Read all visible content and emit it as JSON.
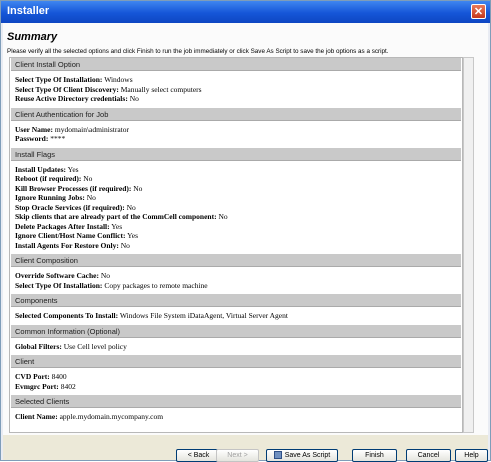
{
  "window": {
    "title": "Installer"
  },
  "heading": "Summary",
  "instructions": "Please verify all the selected options and click Finish to run the job immediately or click Save As Script to save the job options as a script.",
  "sections": [
    {
      "title": "Client Install Option",
      "rows": [
        {
          "label": "Select Type Of Installation:",
          "value": "Windows"
        },
        {
          "label": "Select Type Of Client Discovery:",
          "value": "Manually select computers"
        },
        {
          "label": "Reuse Active Directory credentials:",
          "value": "No"
        }
      ]
    },
    {
      "title": "Client Authentication for Job",
      "rows": [
        {
          "label": "User Name:",
          "value": "mydomain\\administrator"
        },
        {
          "label": "Password:",
          "value": "****"
        }
      ]
    },
    {
      "title": "Install Flags",
      "rows": [
        {
          "label": "Install Updates:",
          "value": "Yes"
        },
        {
          "label": "Reboot (if required):",
          "value": "No"
        },
        {
          "label": "Kill Browser Processes (if required):",
          "value": "No"
        },
        {
          "label": "Ignore Running Jobs:",
          "value": "No"
        },
        {
          "label": "Stop Oracle Services (if required):",
          "value": "No"
        },
        {
          "label": "Skip clients that are already part of the CommCell component:",
          "value": "No"
        },
        {
          "label": "Delete Packages After Install:",
          "value": "Yes"
        },
        {
          "label": "Ignore Client/Host Name Conflict:",
          "value": "Yes"
        },
        {
          "label": "Install Agents For Restore Only:",
          "value": "No"
        }
      ]
    },
    {
      "title": "Client Composition",
      "rows": [
        {
          "label": "Override Software Cache:",
          "value": "No"
        },
        {
          "label": "Select Type Of Installation:",
          "value": "Copy packages to remote machine"
        }
      ]
    },
    {
      "title": "Components",
      "rows": [
        {
          "label": "Selected Components To Install:",
          "value": "Windows File System iDataAgent, Virtual Server Agent"
        }
      ]
    },
    {
      "title": "Common Information (Optional)",
      "rows": [
        {
          "label": "Global Filters:",
          "value": "Use Cell level policy"
        }
      ]
    },
    {
      "title": "Client",
      "rows": [
        {
          "label": "CVD Port:",
          "value": "8400"
        },
        {
          "label": "Evmgrc Port:",
          "value": "8402"
        }
      ]
    },
    {
      "title": "Selected Clients",
      "rows": [
        {
          "label": "Client Name:",
          "value": "apple.mydomain.mycompany.com"
        }
      ]
    }
  ],
  "buttons": {
    "back": "< Back",
    "next": "Next >",
    "save_as_script": "Save As Script",
    "finish": "Finish",
    "cancel": "Cancel",
    "help": "Help"
  },
  "icons": {
    "close": "close-icon",
    "save": "save-script-icon"
  }
}
